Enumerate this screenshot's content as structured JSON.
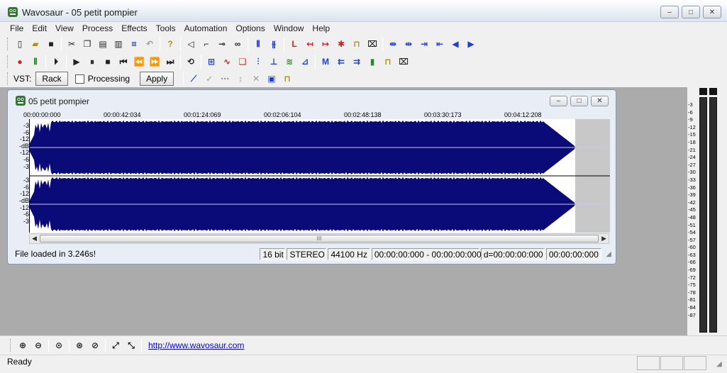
{
  "window": {
    "title": "Wavosaur - 05 petit pompier",
    "controls": {
      "minimize": "–",
      "maximize": "□",
      "close": "✕"
    }
  },
  "menu": [
    "File",
    "Edit",
    "View",
    "Process",
    "Effects",
    "Tools",
    "Automation",
    "Options",
    "Window",
    "Help"
  ],
  "vst": {
    "label": "VST:",
    "rack_button": "Rack",
    "processing_label": "Processing",
    "processing_checked": false,
    "apply_button": "Apply"
  },
  "document": {
    "title": "05 petit pompier",
    "timeline_labels": [
      "00:00:00:000",
      "00:00:42:034",
      "00:01:24:069",
      "00:02:06:104",
      "00:02:48:138",
      "00:03:30:173",
      "00:04:12:208"
    ],
    "db_scale": [
      "-3",
      "-6",
      "-12",
      "-dB",
      "-12",
      "-6",
      "-3"
    ],
    "scroll_thumb": "III",
    "status": {
      "message": "File loaded in 3.246s!",
      "bit_depth": "16 bit",
      "channels": "STEREO",
      "sample_rate": "44100 Hz",
      "selection": "00:00:00:000 - 00:00:00:000",
      "duration": "d=00:00:00:000",
      "cursor": "00:00:00:000"
    }
  },
  "vu_scale": [
    "-3",
    "-6",
    "-9",
    "-12",
    "-15",
    "-18",
    "-21",
    "-24",
    "-27",
    "-30",
    "-33",
    "-36",
    "-39",
    "-42",
    "-45",
    "-48",
    "-51",
    "-54",
    "-57",
    "-60",
    "-63",
    "-66",
    "-69",
    "-72",
    "-75",
    "-78",
    "-81",
    "-84",
    "-87"
  ],
  "bottom_link": "http://www.wavosaur.com",
  "statusbar": {
    "text": "Ready"
  },
  "colors": {
    "waveform": "#0a0a78",
    "mdi_background": "#ababab",
    "link": "#0000ee"
  }
}
